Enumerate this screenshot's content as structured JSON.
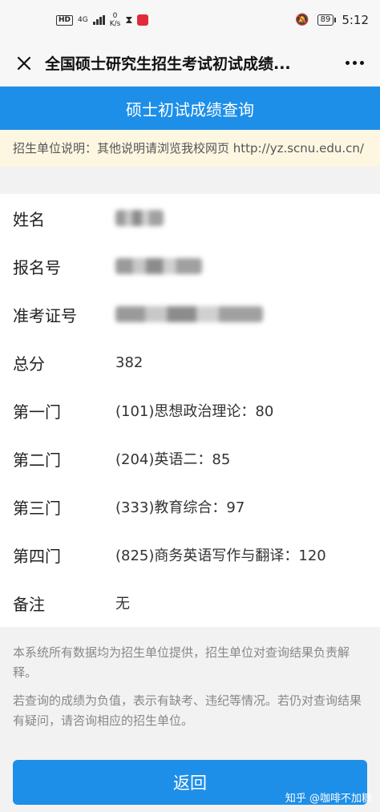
{
  "status_bar": {
    "network_chip": "HD",
    "net_type": "4G",
    "speed_value": "0",
    "speed_unit": "K/s",
    "battery": "89",
    "time": "5:12"
  },
  "nav": {
    "title": "全国硕士研究生招生考试初试成绩..."
  },
  "header": {
    "title": "硕士初试成绩查询"
  },
  "notice": {
    "text": "招生单位说明：其他说明请浏览我校网页 http://yz.scnu.edu.cn/"
  },
  "info": {
    "rows": [
      {
        "label": "姓名",
        "value": ""
      },
      {
        "label": "报名号",
        "value": ""
      },
      {
        "label": "准考证号",
        "value": ""
      },
      {
        "label": "总分",
        "value": "382"
      },
      {
        "label": "第一门",
        "value": "(101)思想政治理论：80"
      },
      {
        "label": "第二门",
        "value": "(204)英语二：85"
      },
      {
        "label": "第三门",
        "value": "(333)教育综合：97"
      },
      {
        "label": "第四门",
        "value": "(825)商务英语写作与翻译：120"
      },
      {
        "label": "备注",
        "value": "无"
      }
    ]
  },
  "footnote": {
    "line1": "本系统所有数据均为招生单位提供，招生单位对查询结果负责解释。",
    "line2": "若查询的成绩为负值，表示有缺考、违纪等情况。若仍对查询结果有疑问，请咨询相应的招生单位。"
  },
  "actions": {
    "back_label": "返回"
  },
  "watermark": {
    "text": "知乎 @咖啡不加糖"
  },
  "colors": {
    "primary": "#1e8fe8",
    "notice_bg": "#fdf7e2"
  }
}
